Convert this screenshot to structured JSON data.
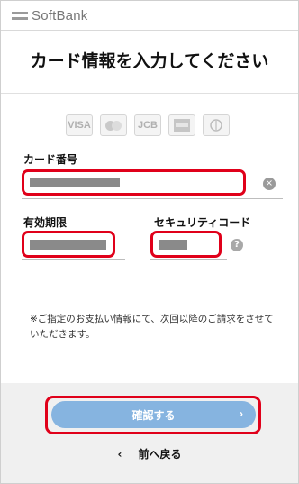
{
  "header": {
    "brand_name": "SoftBank"
  },
  "page": {
    "title": "カード情報を入力してください"
  },
  "card_brands": [
    {
      "name": "VISA",
      "icon": "visa-logo"
    },
    {
      "name": "",
      "icon": "mastercard-logo"
    },
    {
      "name": "JCB",
      "icon": "jcb-logo"
    },
    {
      "name": "",
      "icon": "amex-logo"
    },
    {
      "name": "",
      "icon": "diners-club-logo"
    }
  ],
  "form": {
    "card_number_label": "カード番号",
    "expiry_label": "有効期限",
    "security_code_label": "セキュリティコード",
    "clear_icon": "×",
    "help_icon": "?"
  },
  "notice": "※ご指定のお支払い情報にて、次回以降のご請求をさせていただきます。",
  "actions": {
    "confirm_label": "確認する",
    "confirm_chevron": "›",
    "back_label": "前へ戻る",
    "back_chevron": "‹"
  },
  "colors": {
    "highlight": "#e0001a",
    "button": "#86b4e0",
    "footer_bg": "#f0f0f0"
  }
}
